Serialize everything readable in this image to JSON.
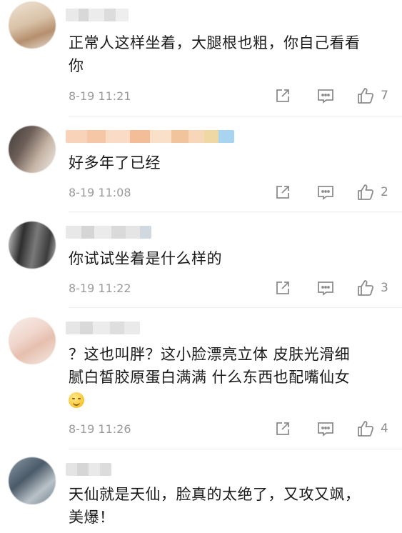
{
  "comments": [
    {
      "text_lines": [
        "正常人这样坐着，大腿根也粗，你自己看看",
        "你"
      ],
      "time": "8-19 11:21",
      "likes": "7"
    },
    {
      "text_lines": [
        "好多年了已经"
      ],
      "time": "8-19 11:08",
      "likes": "2"
    },
    {
      "text_lines": [
        "你试试坐着是什么样的"
      ],
      "time": "8-19 11:22",
      "likes": "3"
    },
    {
      "text_lines": [
        "？这也叫胖？这小脸漂亮立体 皮肤光滑细",
        "腻白皙胶原蛋白满满 什么东西也配嘴仙女"
      ],
      "time": "8-19 11:26",
      "likes": "4"
    },
    {
      "text_lines": [
        "天仙就是天仙，脸真的太绝了，又攻又飒，",
        "美爆！"
      ]
    }
  ],
  "icons": {
    "share": "share-icon",
    "reply": "comment-icon",
    "like": "thumbs-up-icon",
    "emoji": "grinning-emoji"
  },
  "colors": {
    "text": "#1a1a1a",
    "meta": "#9a9a9a",
    "icon": "#8c8c8c",
    "divider": "#ececec"
  }
}
